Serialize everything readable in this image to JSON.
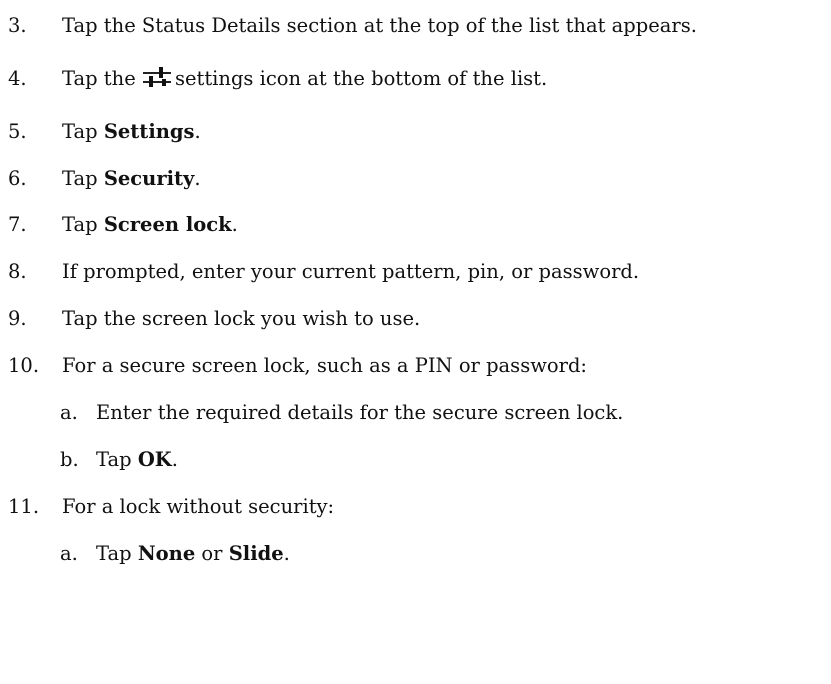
{
  "steps": [
    {
      "num": "3.",
      "text": "Tap the Status Details section at the top of the list that appears."
    },
    {
      "num": "4.",
      "pre": "Tap the",
      "icon": "settings-sliders-icon",
      "post": "settings icon at the bottom of the list."
    },
    {
      "num": "5.",
      "pre": "Tap ",
      "bold": "Settings",
      "post": "."
    },
    {
      "num": "6.",
      "pre": "Tap ",
      "bold": "Security",
      "post": "."
    },
    {
      "num": "7.",
      "pre": "Tap ",
      "bold": "Screen lock",
      "post": "."
    },
    {
      "num": "8.",
      "text": "If prompted, enter your current pattern, pin, or password."
    },
    {
      "num": "9.",
      "text": "Tap the screen lock you wish to use."
    },
    {
      "num": "10.",
      "text": "For a secure screen lock, such as a PIN or password:"
    },
    {
      "num": "a.",
      "text": "Enter the required details for the secure screen lock."
    },
    {
      "num": "b.",
      "pre": "Tap ",
      "bold": "OK",
      "post": "."
    },
    {
      "num": "11.",
      "text": "For a lock without security:"
    },
    {
      "num": "a.",
      "pre": "Tap ",
      "bold": "None",
      "mid": " or ",
      "bold2": "Slide",
      "post": "."
    }
  ]
}
